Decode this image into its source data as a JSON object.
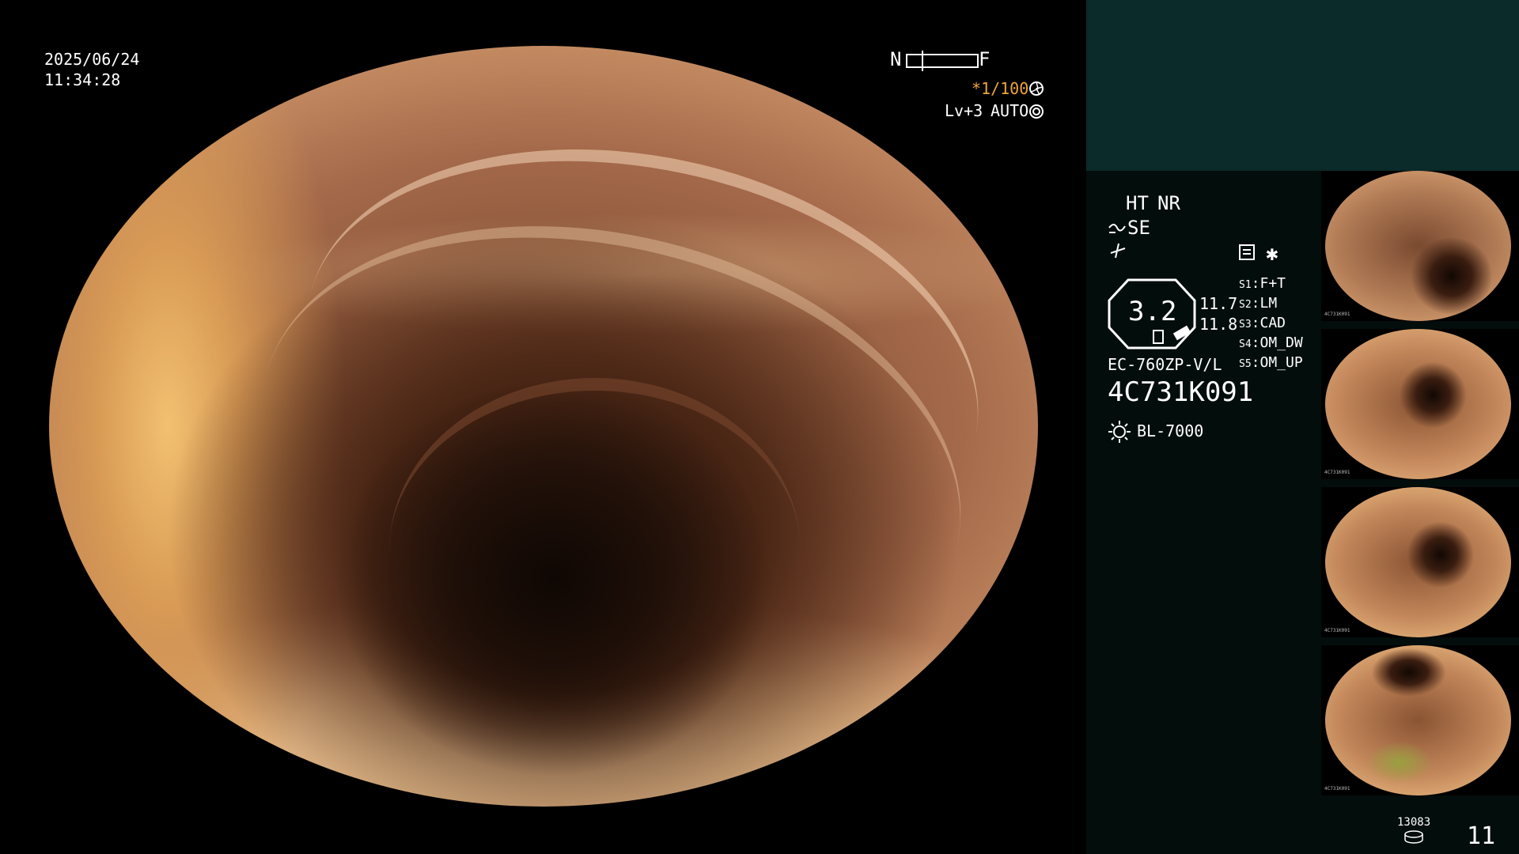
{
  "overlay": {
    "date": "2025/06/24",
    "time": "11:34:28",
    "near_label": "N",
    "far_label": "F",
    "shutter": "*1/100",
    "level": "Lv+3",
    "mode": "AUTO"
  },
  "panel": {
    "ht": "HT",
    "nr": "NR",
    "se": "SE",
    "zoom_value": "3.2",
    "value_1": "11.7",
    "value_2": "11.8",
    "scope_model": "EC-760ZP-V/L",
    "serial": "4C731K091",
    "light_source": "BL-7000",
    "switches": [
      {
        "key": "S1",
        "value": "F+T"
      },
      {
        "key": "S2",
        "value": "LM"
      },
      {
        "key": "S3",
        "value": "CAD"
      },
      {
        "key": "S4",
        "value": "OM_DW"
      },
      {
        "key": "S5",
        "value": "OM_UP"
      }
    ],
    "storage_count": "13083",
    "image_count": "11"
  },
  "thumbnails": [
    {
      "label": "4C731K091"
    },
    {
      "label": "4C731K091"
    },
    {
      "label": "4C731K091"
    },
    {
      "label": "4C731K091"
    }
  ],
  "colors": {
    "accent_orange": "#f0a63a",
    "panel_top": "#0b2a2a",
    "panel_bg": "#030d0c"
  },
  "icons": {
    "shutter": "shutter-aperture-icon",
    "auto": "auto-iris-icon",
    "light": "light-source-icon",
    "storage": "storage-disk-icon",
    "enhance": "structure-enhance-icon",
    "menu": "menu-list-icon"
  }
}
